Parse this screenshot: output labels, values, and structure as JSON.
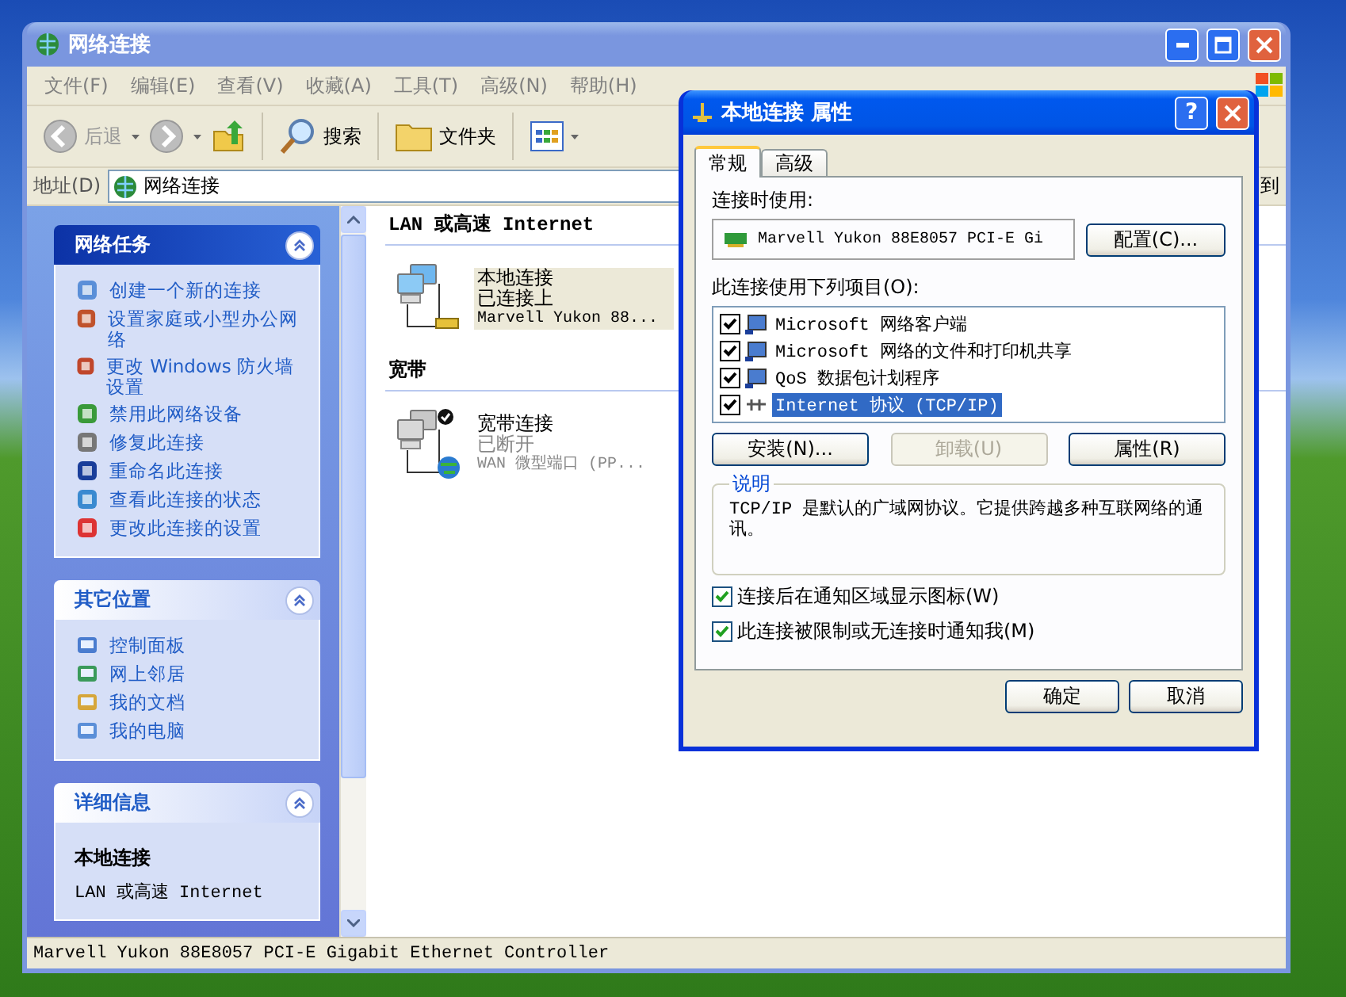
{
  "explorer": {
    "title": "网络连接",
    "menu": [
      "文件(F)",
      "编辑(E)",
      "查看(V)",
      "收藏(A)",
      "工具(T)",
      "高级(N)",
      "帮助(H)"
    ],
    "toolbar": {
      "back": "后退",
      "search": "搜索",
      "folders": "文件夹"
    },
    "address": {
      "label": "地址(D)",
      "value": "网络连接",
      "go": "到"
    },
    "panels": [
      {
        "title": "网络任务",
        "kind": "special",
        "expanded": true,
        "items": [
          "创建一个新的连接",
          "设置家庭或小型办公网络",
          "更改 Windows 防火墙设置",
          "禁用此网络设备",
          "修复此连接",
          "重命名此连接",
          "查看此连接的状态",
          "更改此连接的设置"
        ]
      },
      {
        "title": "其它位置",
        "kind": "normal",
        "expanded": true,
        "items": [
          "控制面板",
          "网上邻居",
          "我的文档",
          "我的电脑"
        ]
      },
      {
        "title": "详细信息",
        "kind": "details",
        "expanded": true,
        "items": [
          "本地连接",
          "LAN 或高速 Internet"
        ]
      }
    ],
    "groups": [
      {
        "heading": "LAN 或高速 Internet",
        "items": [
          {
            "kind": "lan",
            "selected": true,
            "name": "本地连接",
            "status": "已连接上",
            "device": "Marvell Yukon 88..."
          }
        ]
      },
      {
        "heading": "宽带",
        "items": [
          {
            "kind": "broadband",
            "selected": false,
            "name": "宽带连接",
            "status": "已断开",
            "device": "WAN 微型端口 (PP..."
          }
        ]
      }
    ],
    "status_bar": "Marvell Yukon 88E8057 PCI-E Gigabit Ethernet Controller"
  },
  "dialog": {
    "title": "本地连接 属性",
    "help_button": "?",
    "tabs": [
      {
        "label": "常规",
        "selected": true
      },
      {
        "label": "高级",
        "selected": false
      }
    ],
    "connect_using_label": "连接时使用:",
    "adapter": "Marvell Yukon 88E8057 PCI-E Gi",
    "configure_button": "配置(C)...",
    "components_label": "此连接使用下列项目(O):",
    "components": [
      {
        "label": "Microsoft 网络客户端",
        "checked": true,
        "selected": false
      },
      {
        "label": "Microsoft 网络的文件和打印机共享",
        "checked": true,
        "selected": false
      },
      {
        "label": "QoS 数据包计划程序",
        "checked": true,
        "selected": false
      },
      {
        "label": "Internet 协议 (TCP/IP)",
        "checked": true,
        "selected": true
      }
    ],
    "component_buttons": [
      {
        "label": "安装(N)...",
        "disabled": false
      },
      {
        "label": "卸载(U)",
        "disabled": true
      },
      {
        "label": "属性(R)",
        "disabled": false
      }
    ],
    "description": {
      "title": "说明",
      "text": "TCP/IP 是默认的广域网协议。它提供跨越多种互联网络的通讯。"
    },
    "options": [
      {
        "label": "连接后在通知区域显示图标(W)",
        "checked": true
      },
      {
        "label": "此连接被限制或无连接时通知我(M)",
        "checked": true
      }
    ],
    "footer_buttons": [
      "确定",
      "取消"
    ]
  }
}
